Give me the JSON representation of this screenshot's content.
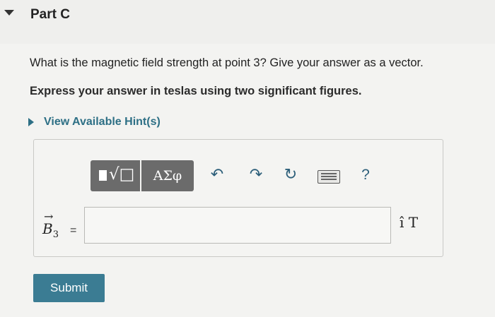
{
  "part": {
    "title": "Part C"
  },
  "question": {
    "text": "What is the magnetic field strength at point 3? Give your answer as a vector.",
    "instruction": "Express your answer in teslas using two significant figures."
  },
  "hints": {
    "label": "View Available Hint(s)"
  },
  "toolbar": {
    "templates_glyph": "√□",
    "templates_icon": "fraction-sqrt-template-icon",
    "greek_label": "ΑΣφ",
    "undo_icon": "undo-icon",
    "undo_glyph": "↶",
    "redo_icon": "redo-icon",
    "redo_glyph": "↷",
    "reset_icon": "reset-icon",
    "reset_glyph": "↻",
    "keyboard_icon": "keyboard-icon",
    "help_label": "?"
  },
  "answer": {
    "variable": "B",
    "subscript": "3",
    "vector_arrow": "→",
    "equals": "=",
    "value": "",
    "unit_vector": "î",
    "unit": "T"
  },
  "submit": {
    "label": "Submit"
  },
  "colors": {
    "accent": "#3b7c93",
    "link": "#2d6f85",
    "toolbar_bg": "#6b6b6b"
  }
}
